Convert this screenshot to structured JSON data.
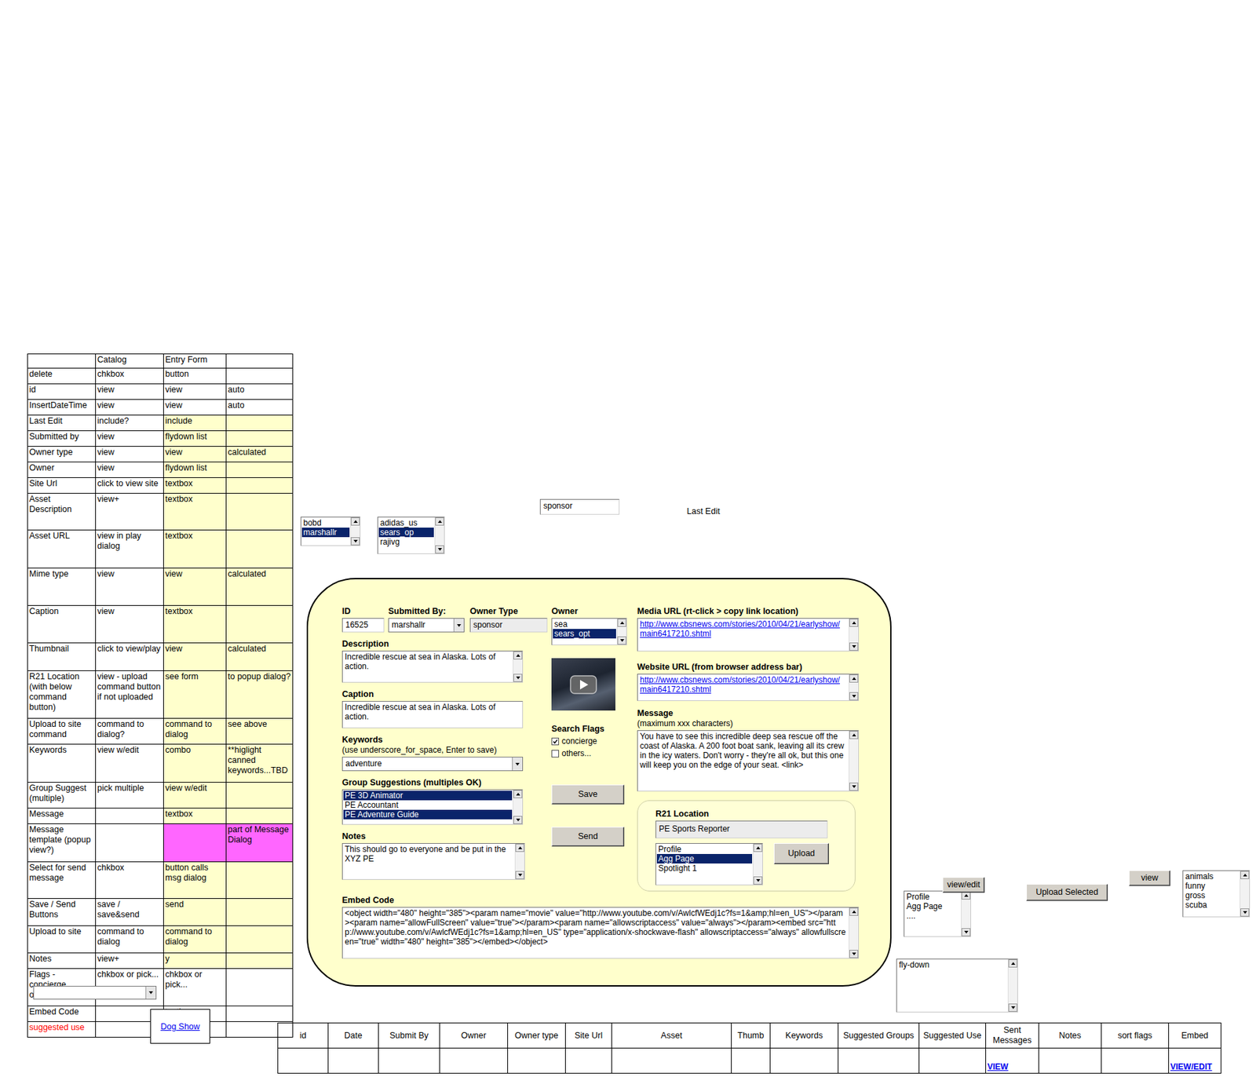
{
  "spec_table": {
    "columns": [
      "",
      "Catalog",
      "Entry Form",
      ""
    ],
    "rows": [
      {
        "cells": [
          "delete",
          "chkbox",
          "button",
          ""
        ],
        "color": "#ffffff",
        "label_color": "#000000"
      },
      {
        "cells": [
          "id",
          "view",
          "view",
          "auto"
        ],
        "color": "#ffffff",
        "label_color": "#000000"
      },
      {
        "cells": [
          "InsertDateTime",
          "view",
          "view",
          "auto"
        ],
        "color": "#ffffff",
        "label_color": "#000000"
      },
      {
        "cells": [
          "Last Edit",
          "include?",
          "include",
          ""
        ],
        "color": "#ffffcc",
        "label_color": "#000000"
      },
      {
        "cells": [
          "Submitted by",
          "view",
          "flydown list",
          ""
        ],
        "color": "#ffffcc",
        "label_color": "#000000"
      },
      {
        "cells": [
          "Owner type",
          "view",
          "view",
          "calculated"
        ],
        "color": "#ffffcc",
        "label_color": "#000000"
      },
      {
        "cells": [
          "Owner",
          "view",
          "flydown list",
          ""
        ],
        "color": "#ffffcc",
        "label_color": "#000000"
      },
      {
        "cells": [
          "Site Url",
          "click to view site",
          "textbox",
          ""
        ],
        "color": "#ffffcc",
        "label_color": "#000000"
      },
      {
        "cells": [
          "Asset Description",
          "view+",
          "textbox",
          ""
        ],
        "color": "#ffffcc",
        "label_color": "#000000"
      },
      {
        "cells": [
          "Asset URL",
          "view in play dialog",
          "textbox",
          ""
        ],
        "color": "#ffffcc",
        "label_color": "#000000"
      },
      {
        "cells": [
          "Mime type",
          "view",
          "view",
          "calculated"
        ],
        "color": "#ffffcc",
        "label_color": "#000000"
      },
      {
        "cells": [
          "Caption",
          "view",
          "textbox",
          ""
        ],
        "color": "#ffffcc",
        "label_color": "#000000"
      },
      {
        "cells": [
          "Thumbnail",
          "click to view/play",
          "view",
          "calculated"
        ],
        "color": "#ffffcc",
        "label_color": "#000000"
      },
      {
        "cells": [
          "R21 Location (with below command button)",
          "view - upload command button if not uploaded",
          "see form",
          "to popup dialog?"
        ],
        "color": "#ffffcc",
        "label_color": "#000000"
      },
      {
        "cells": [
          "Upload to site command",
          "command to dialog?",
          "command to dialog",
          "see above"
        ],
        "color": "#ffffcc",
        "label_color": "#000000"
      },
      {
        "cells": [
          "Keywords",
          "view w/edit",
          "combo",
          "**higlight canned keywords...TBD"
        ],
        "color": "#ffffcc",
        "label_color": "#000000"
      },
      {
        "cells": [
          "Group Suggest (multiple)",
          "pick multiple",
          "view w/edit",
          ""
        ],
        "color": "#ffffcc",
        "label_color": "#000000"
      },
      {
        "cells": [
          "Message",
          "",
          "textbox",
          ""
        ],
        "color": "#ffffcc",
        "label_color": "#000000"
      },
      {
        "cells": [
          "Message template (popup view?)",
          "",
          "",
          "part of Message Dialog"
        ],
        "color": "#ff66ff",
        "label_color": "#000000"
      },
      {
        "cells": [
          "Select for send message",
          "chkbox",
          "button calls msg dialog",
          ""
        ],
        "color": "#ffffcc",
        "label_color": "#000000"
      },
      {
        "cells": [
          "Save / Send Buttons",
          "save / save&send",
          "send",
          ""
        ],
        "color": "#ffffcc",
        "label_color": "#000000"
      },
      {
        "cells": [
          "Upload to site",
          "command to dialog",
          "command to dialog",
          ""
        ],
        "color": "#ffffcc",
        "label_color": "#000000"
      },
      {
        "cells": [
          "Notes",
          "view+",
          "y",
          ""
        ],
        "color": "#ffffcc",
        "label_color": "#000000"
      },
      {
        "cells": [
          "Flags - concierge, others",
          "chkbox or pick...",
          "chkbox or pick...",
          ""
        ],
        "color": "#ffffff",
        "label_color": "#000000"
      },
      {
        "cells": [
          "Embed Code",
          "",
          "textbox",
          ""
        ],
        "color": "#ffffff",
        "label_color": "#000000"
      },
      {
        "cells": [
          "suggested use",
          "",
          "",
          ""
        ],
        "color": "#ffffff",
        "label_color": "#ff0000"
      }
    ]
  },
  "dog_show_link": "Dog Show",
  "loose_controls": {
    "submitted_by_list": [
      {
        "label": "bobd",
        "selected": false
      },
      {
        "label": "marshallr",
        "selected": true
      }
    ],
    "owner_list": [
      {
        "label": "adidas_us",
        "selected": false
      },
      {
        "label": "sears_op",
        "selected": true
      },
      {
        "label": "rajivg",
        "selected": false
      }
    ],
    "owner_type_field": "sponsor",
    "last_edit_label": "Last Edit"
  },
  "entry_form": {
    "id": {
      "label": "ID",
      "value": "16525"
    },
    "submitted_by": {
      "label": "Submitted By:",
      "value": "marshallr"
    },
    "owner_type": {
      "label": "Owner Type",
      "value": "sponsor"
    },
    "owner": {
      "label": "Owner",
      "options": [
        {
          "label": "sea",
          "selected": false
        },
        {
          "label": "sears_opt",
          "selected": true
        }
      ]
    },
    "description": {
      "label": "Description",
      "value": "Incredible rescue at sea in Alaska. Lots of action."
    },
    "caption": {
      "label": "Caption",
      "value": "Incredible rescue at sea in Alaska. Lots of action."
    },
    "keywords": {
      "label": "Keywords",
      "hint": "(use underscore_for_space, Enter to save)",
      "value": "adventure"
    },
    "group_suggestions": {
      "label": "Group Suggestions (multiples OK)",
      "options": [
        {
          "label": "PE  3D Animator",
          "selected": true
        },
        {
          "label": "PE  Accountant",
          "selected": false
        },
        {
          "label": "PE  Adventure Guide",
          "selected": true
        }
      ]
    },
    "notes": {
      "label": "Notes",
      "value": "This should go to everyone and be put in the XYZ PE"
    },
    "embed_code": {
      "label": "Embed Code",
      "value": "<object width=\"480\" height=\"385\"><param name=\"movie\" value=\"http://www.youtube.com/v/AwlcfWEdj1c?fs=1&amp;hl=en_US\"></param><param  name=\"allowFullScreen\"  value=\"true\"></param><param name=\"allowscriptaccess\" value=\"always\"></param><embed src=\"http://www.youtube.com/v/AwlcfWEdj1c?fs=1&amp;hl=en_US\" type=\"application/x-shockwave-flash\" allowscriptaccess=\"always\" allowfullscreen=\"true\" width=\"480\" height=\"385\"></embed></object>"
    },
    "search_flags": {
      "label": "Search Flags",
      "options": [
        {
          "label": "concierge",
          "checked": true
        },
        {
          "label": "others...",
          "checked": false
        }
      ]
    },
    "save_button": "Save",
    "send_button": "Send",
    "media_url": {
      "label": "Media URL (rt-click > copy link location)",
      "value": "http://www.cbsnews.com/stories/2010/04/21/earlyshow/main6417210.shtml"
    },
    "website_url": {
      "label": "Website URL (from browser address bar)",
      "value": "http://www.cbsnews.com/stories/2010/04/21/earlyshow/main6417210.shtml"
    },
    "message": {
      "label": "Message",
      "hint": "(maximum xxx characters)",
      "value": "You have to see this incredible deep sea rescue off the coast of Alaska.  A 200 foot boat sank, leaving all its crew in the icy waters.  Don't worry - they're all ok, but this one will keep you on the edge of your seat. <link>"
    },
    "r21_location": {
      "label": "R21 Location",
      "value": "PE Sports Reporter",
      "options": [
        {
          "label": "Profile",
          "selected": false
        },
        {
          "label": "Agg Page",
          "selected": true
        },
        {
          "label": "Spotlight 1",
          "selected": false
        }
      ],
      "button": "Upload"
    }
  },
  "side_controls": {
    "view_edit_button": "view/edit",
    "page_list": [
      {
        "label": "Profile",
        "selected": false
      },
      {
        "label": "Agg Page",
        "selected": false
      },
      {
        "label": "....",
        "selected": false
      }
    ],
    "upload_selected_button": "Upload Selected",
    "view_button": "view",
    "tag_list": [
      {
        "label": "animals",
        "selected": false
      },
      {
        "label": "funny",
        "selected": false
      },
      {
        "label": "gross",
        "selected": false
      },
      {
        "label": "scuba",
        "selected": false
      }
    ],
    "fly_down": "fly-down"
  },
  "catalog_table": {
    "columns": [
      "id",
      "Date",
      "Submit By",
      "Owner",
      "Owner type",
      "Site Url",
      "Asset",
      "Thumb",
      "Keywords",
      "Suggested Groups",
      "Suggested Use",
      "Sent Messages",
      "Notes",
      "sort flags",
      "Embed"
    ],
    "rows": [
      [
        "",
        "",
        "",
        "",
        "",
        "",
        "",
        "",
        "",
        "",
        "",
        "VIEW",
        "",
        "",
        "VIEW/EDIT"
      ]
    ]
  }
}
